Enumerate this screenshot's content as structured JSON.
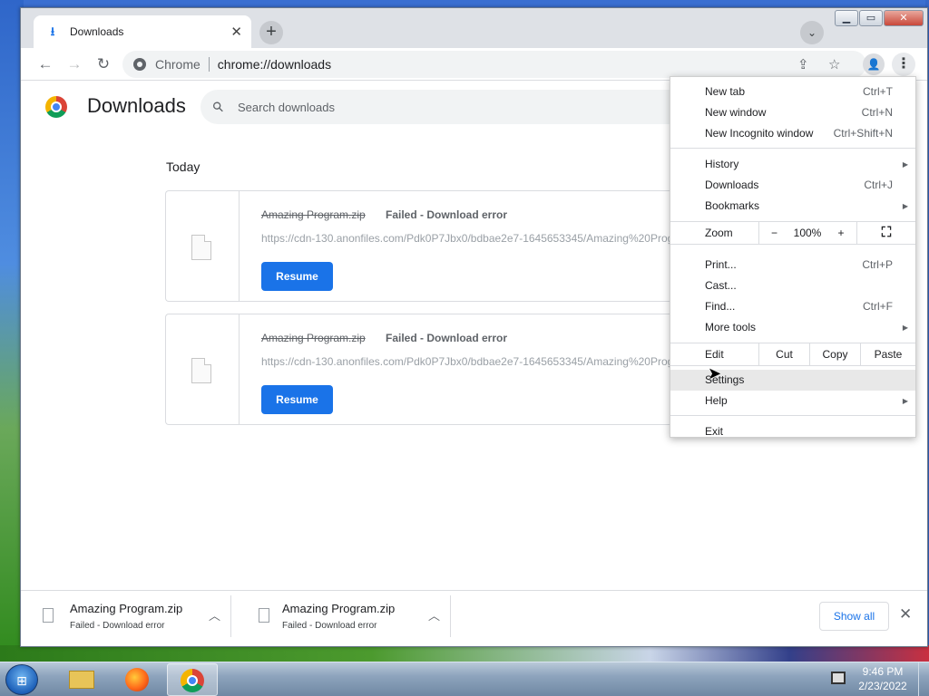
{
  "tab": {
    "title": "Downloads"
  },
  "address": {
    "chip": "Chrome",
    "url": "chrome://downloads"
  },
  "page": {
    "title": "Downloads",
    "search_placeholder": "Search downloads"
  },
  "section": {
    "date": "Today"
  },
  "downloads": [
    {
      "name": "Amazing Program.zip",
      "status": "Failed - Download error",
      "url": "https://cdn-130.anonfiles.com/Pdk0P7Jbx0/bdbae2e7-1645653345/Amazing%20Program.zip",
      "action": "Resume"
    },
    {
      "name": "Amazing Program.zip",
      "status": "Failed - Download error",
      "url": "https://cdn-130.anonfiles.com/Pdk0P7Jbx0/bdbae2e7-1645653345/Amazing%20Program.zip",
      "action": "Resume"
    }
  ],
  "menu": {
    "new_tab": {
      "label": "New tab",
      "shortcut": "Ctrl+T"
    },
    "new_window": {
      "label": "New window",
      "shortcut": "Ctrl+N"
    },
    "new_incognito": {
      "label": "New Incognito window",
      "shortcut": "Ctrl+Shift+N"
    },
    "history": {
      "label": "History"
    },
    "downloads": {
      "label": "Downloads",
      "shortcut": "Ctrl+J"
    },
    "bookmarks": {
      "label": "Bookmarks"
    },
    "zoom": {
      "label": "Zoom",
      "minus": "−",
      "value": "100%",
      "plus": "+"
    },
    "print": {
      "label": "Print...",
      "shortcut": "Ctrl+P"
    },
    "cast": {
      "label": "Cast..."
    },
    "find": {
      "label": "Find...",
      "shortcut": "Ctrl+F"
    },
    "more_tools": {
      "label": "More tools"
    },
    "edit": {
      "label": "Edit",
      "cut": "Cut",
      "copy": "Copy",
      "paste": "Paste"
    },
    "settings": {
      "label": "Settings"
    },
    "help": {
      "label": "Help"
    },
    "exit": {
      "label": "Exit"
    }
  },
  "shelf": {
    "items": [
      {
        "name": "Amazing Program.zip",
        "status": "Failed - Download error"
      },
      {
        "name": "Amazing Program.zip",
        "status": "Failed - Download error"
      }
    ],
    "show_all": "Show all"
  },
  "taskbar": {
    "time": "9:46 PM",
    "date": "2/23/2022"
  },
  "colors": {
    "accent": "#1a73e8",
    "tab_strip": "#dee1e6",
    "omnibox": "#f1f3f4"
  }
}
